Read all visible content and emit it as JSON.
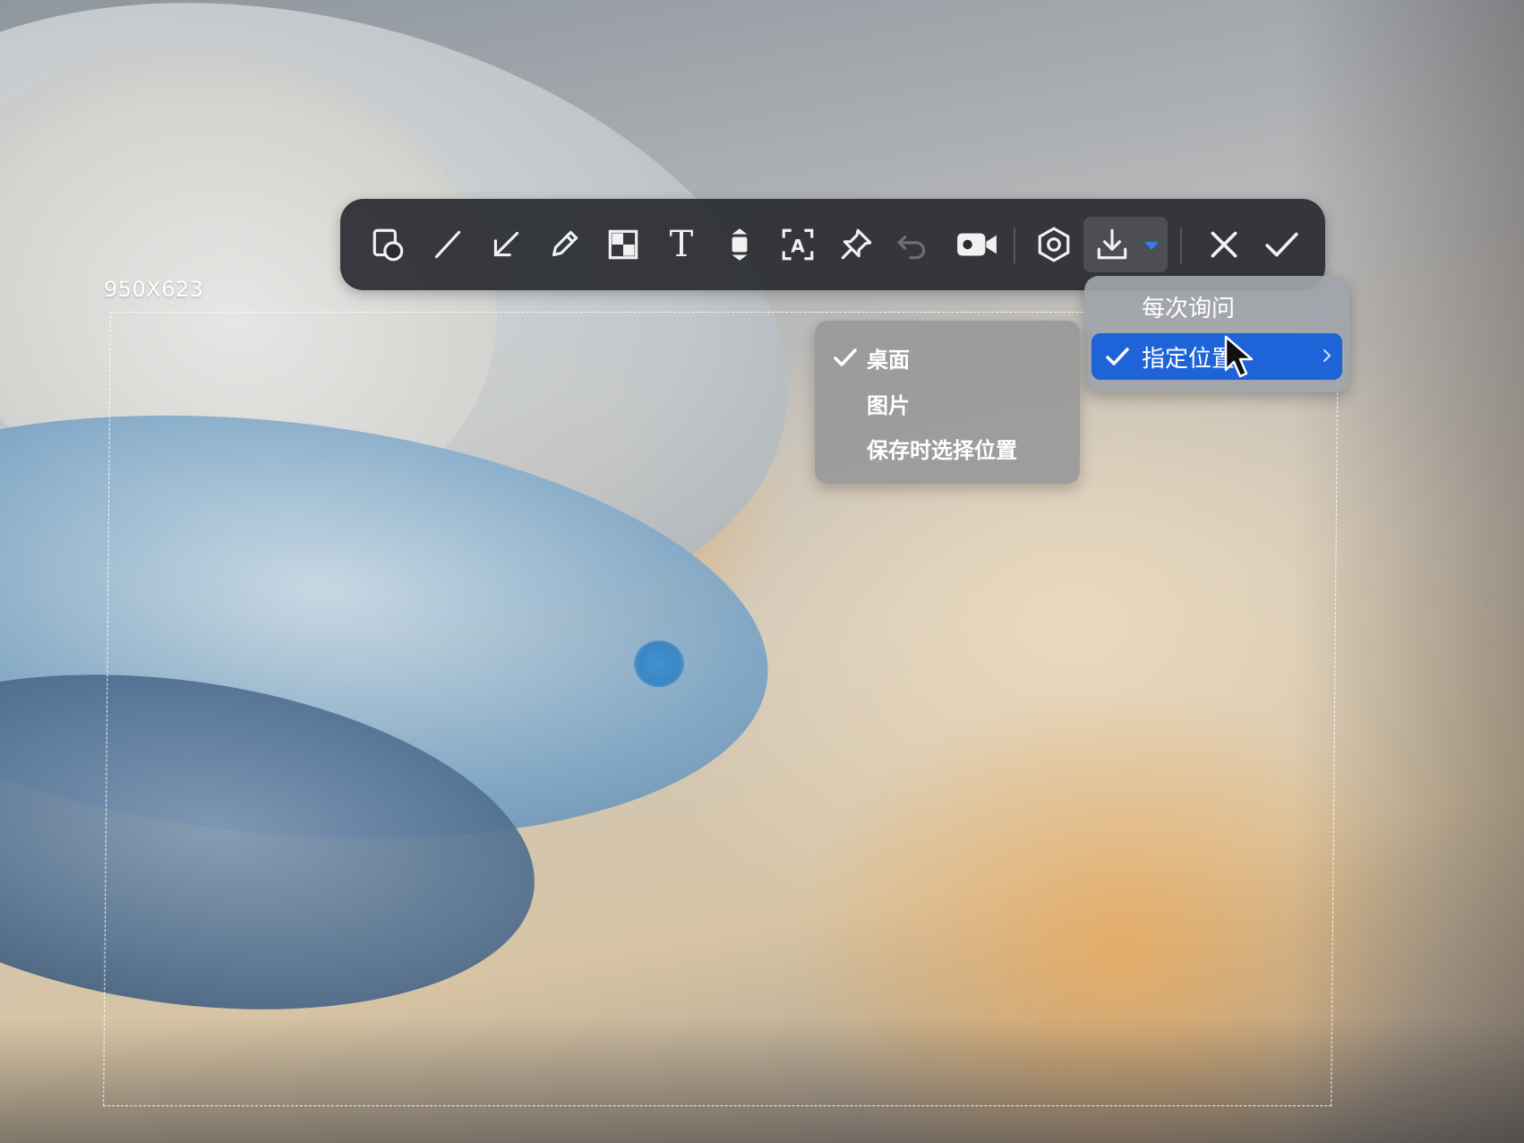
{
  "capture": {
    "size_label": "950X623"
  },
  "toolbar": {
    "tools": [
      {
        "icon": "shape-icon",
        "label": ""
      },
      {
        "icon": "line-icon",
        "label": ""
      },
      {
        "icon": "arrow-icon",
        "label": ""
      },
      {
        "icon": "pencil-icon",
        "label": ""
      },
      {
        "icon": "mosaic-icon",
        "label": ""
      },
      {
        "icon": "text-icon",
        "label": "T"
      },
      {
        "icon": "long-screenshot-icon",
        "label": ""
      },
      {
        "icon": "ocr-icon",
        "label": "A"
      },
      {
        "icon": "pin-icon",
        "label": ""
      },
      {
        "icon": "undo-icon",
        "label": ""
      },
      {
        "icon": "record-video-icon",
        "label": ""
      },
      {
        "icon": "settings-icon",
        "label": ""
      },
      {
        "icon": "save-icon",
        "label": ""
      },
      {
        "icon": "close-icon",
        "label": ""
      },
      {
        "icon": "confirm-icon",
        "label": ""
      }
    ],
    "accent_color": "#2f7df0"
  },
  "save_menu": {
    "items": [
      {
        "label": "每次询问",
        "checked": false
      },
      {
        "label": "指定位置",
        "checked": true,
        "has_submenu": true
      }
    ]
  },
  "location_submenu": {
    "items": [
      {
        "label": "桌面",
        "checked": true
      },
      {
        "label": "图片",
        "checked": false
      },
      {
        "label": "保存时选择位置",
        "checked": false
      }
    ]
  },
  "colors": {
    "toolbar_bg": "#2a2c32",
    "selected_item_bg": "#1f63d8",
    "menu_bg": "#a0a4aa"
  }
}
